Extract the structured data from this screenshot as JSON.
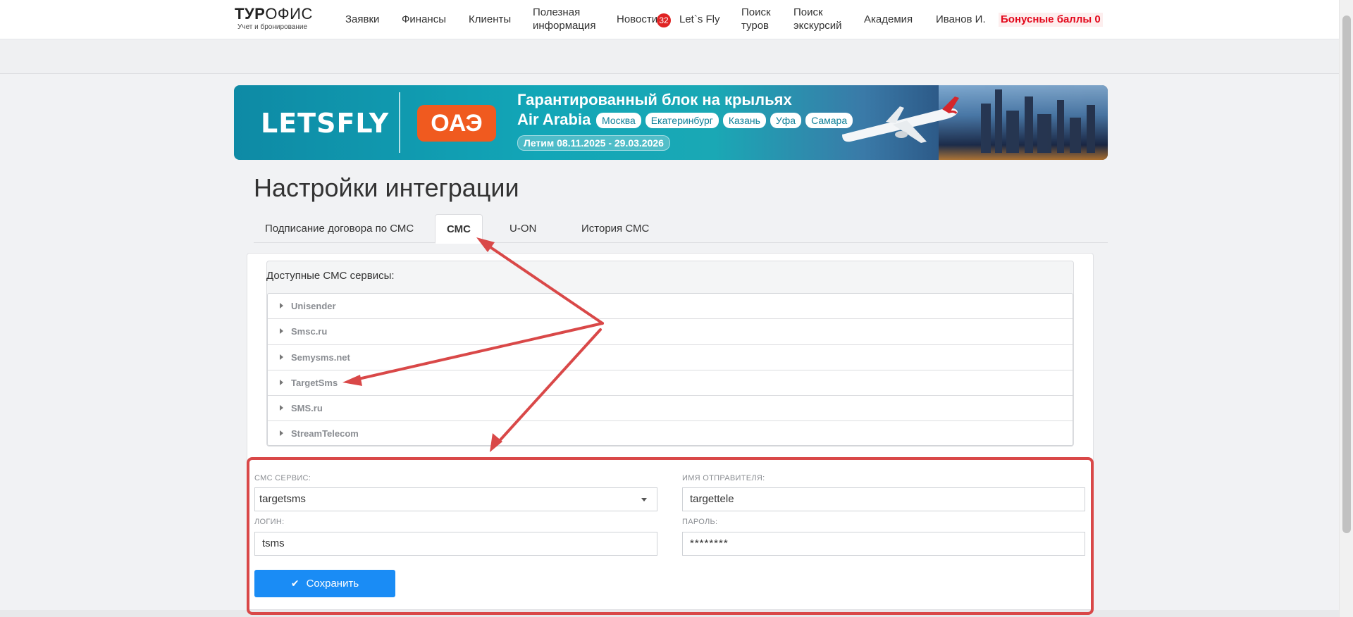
{
  "header": {
    "logo_bold": "ТУР",
    "logo_rest": "ОФИС",
    "logo_subtitle": "Учет и бронирование",
    "nav": [
      "Заявки",
      "Финансы",
      "Клиенты",
      "Полезная информация",
      "Новости",
      "Let`s Fly",
      "Поиск туров",
      "Поиск экскурсий",
      "Академия",
      "Иванов И."
    ],
    "news_badge": "32",
    "bonus": "Бонусные баллы 0"
  },
  "banner": {
    "brand": "LETSFLY",
    "country": "ОАЭ",
    "title": "Гарантированный блок на крыльях",
    "airline": "Air Arabia",
    "cities": [
      "Москва",
      "Екатеринбург",
      "Казань",
      "Уфа",
      "Самара"
    ],
    "dates": "Летим 08.11.2025 - 29.03.2026"
  },
  "page": {
    "title": "Настройки интеграции",
    "tabs": [
      "Подписание договора по СМС",
      "СМС",
      "U-ON",
      "История СМС"
    ],
    "active_tab": "СМС"
  },
  "services": {
    "label": "Доступные СМС сервисы:",
    "items": [
      "Unisender",
      "Smsc.ru",
      "Semysms.net",
      "TargetSms",
      "SMS.ru",
      "StreamTelecom"
    ]
  },
  "form": {
    "service_label": "СМС СЕРВИС:",
    "service_value": "targetsms",
    "sender_label": "ИМЯ ОТПРАВИТЕЛЯ:",
    "sender_value": "targettele",
    "login_label": "ЛОГИН:",
    "login_value": "tsms",
    "password_label": "ПАРОЛЬ:",
    "password_value": "********",
    "save_label": "Сохранить"
  },
  "colors": {
    "accent": "#1a8cf5",
    "bonus": "#e3081c",
    "annotation": "#d94848",
    "banner_orange": "#f05a1f"
  }
}
